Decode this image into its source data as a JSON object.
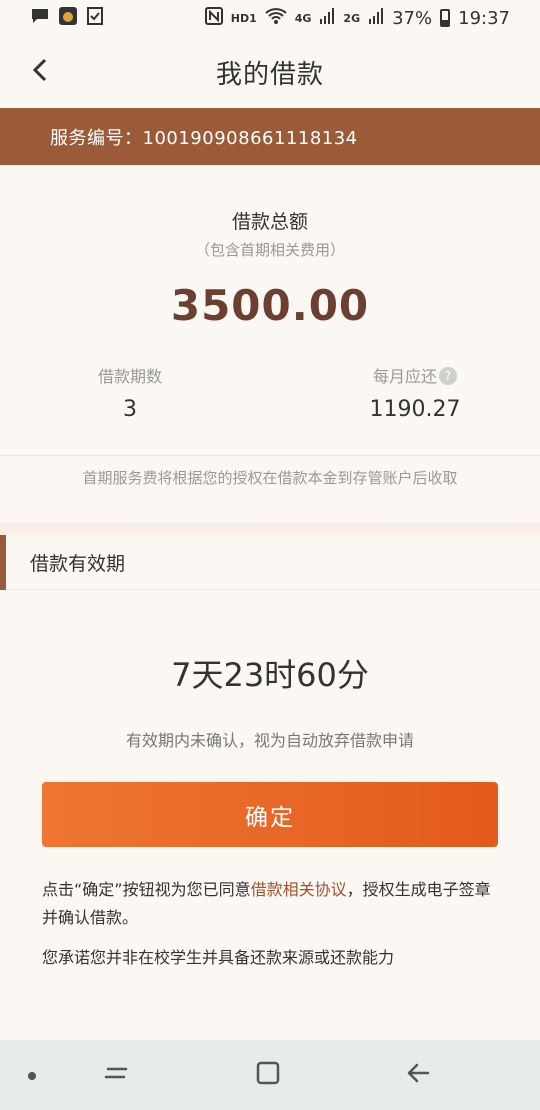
{
  "status_bar": {
    "network": "HD1",
    "signal_label": "4G",
    "signal_label2": "2G",
    "battery": "37%",
    "time": "19:37"
  },
  "header": {
    "title": "我的借款"
  },
  "serial": {
    "text": "服务编号：100190908661118134"
  },
  "loan": {
    "total_label": "借款总额",
    "total_note": "（包含首期相关费用）",
    "total_amount": "3500.00",
    "periods_label": "借款期数",
    "periods_value": "3",
    "monthly_label": "每月应还",
    "monthly_value": "1190.27",
    "fee_note": "首期服务费将根据您的授权在借款本金到存管账户后收取"
  },
  "validity": {
    "section_title": "借款有效期",
    "countdown": "7天23时60分",
    "note": "有效期内未确认，视为自动放弃借款申请"
  },
  "actions": {
    "confirm_label": "确定"
  },
  "agreement": {
    "prefix": "点击“确定”按钮视为您已同意",
    "link": "借款相关协议",
    "suffix": "，授权生成电子签章并确认借款。",
    "promise": "您承诺您并非在校学生并具备还款来源或还款能力"
  },
  "icons": {
    "back": "chevron-left-icon",
    "help": "question-circle-icon",
    "help_glyph": "?"
  }
}
